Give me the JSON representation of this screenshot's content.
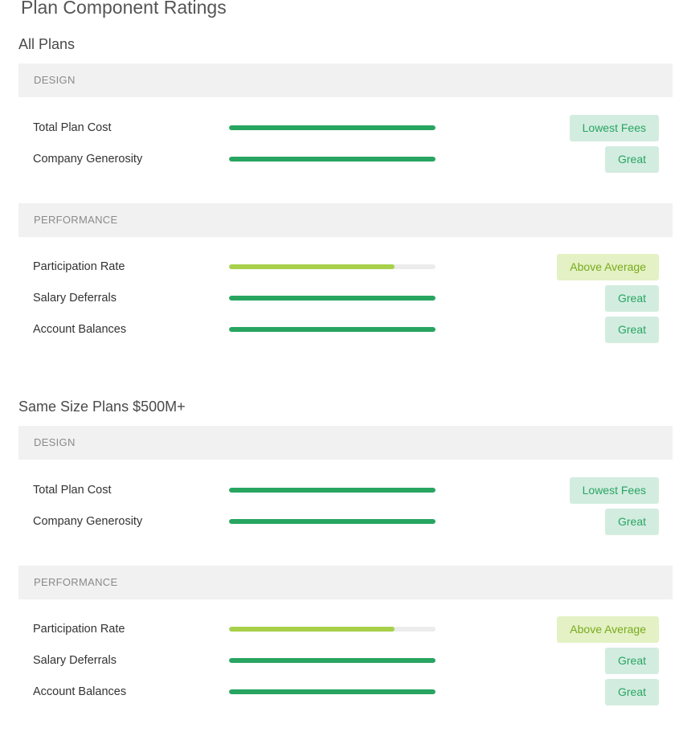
{
  "page_title": "Plan Component Ratings",
  "colors": {
    "great_fill": "#27a561",
    "above_average_fill": "#a8d04b",
    "great_badge_bg": "#d3ece0",
    "great_badge_text": "#27a561",
    "above_average_badge_bg": "#e3f1c4",
    "above_average_badge_text": "#7aaa1c"
  },
  "sections": [
    {
      "title": "All Plans",
      "groups": [
        {
          "header": "DESIGN",
          "rows": [
            {
              "label": "Total Plan Cost",
              "rating": "Lowest Fees",
              "level": 1.0,
              "tone": "great"
            },
            {
              "label": "Company Generosity",
              "rating": "Great",
              "level": 1.0,
              "tone": "great"
            }
          ]
        },
        {
          "header": "PERFORMANCE",
          "rows": [
            {
              "label": "Participation Rate",
              "rating": "Above Average",
              "level": 0.8,
              "tone": "above_average"
            },
            {
              "label": "Salary Deferrals",
              "rating": "Great",
              "level": 1.0,
              "tone": "great"
            },
            {
              "label": "Account Balances",
              "rating": "Great",
              "level": 1.0,
              "tone": "great"
            }
          ]
        }
      ]
    },
    {
      "title": "Same Size Plans $500M+",
      "groups": [
        {
          "header": "DESIGN",
          "rows": [
            {
              "label": "Total Plan Cost",
              "rating": "Lowest Fees",
              "level": 1.0,
              "tone": "great"
            },
            {
              "label": "Company Generosity",
              "rating": "Great",
              "level": 1.0,
              "tone": "great"
            }
          ]
        },
        {
          "header": "PERFORMANCE",
          "rows": [
            {
              "label": "Participation Rate",
              "rating": "Above Average",
              "level": 0.8,
              "tone": "above_average"
            },
            {
              "label": "Salary Deferrals",
              "rating": "Great",
              "level": 1.0,
              "tone": "great"
            },
            {
              "label": "Account Balances",
              "rating": "Great",
              "level": 1.0,
              "tone": "great"
            }
          ]
        }
      ]
    }
  ]
}
